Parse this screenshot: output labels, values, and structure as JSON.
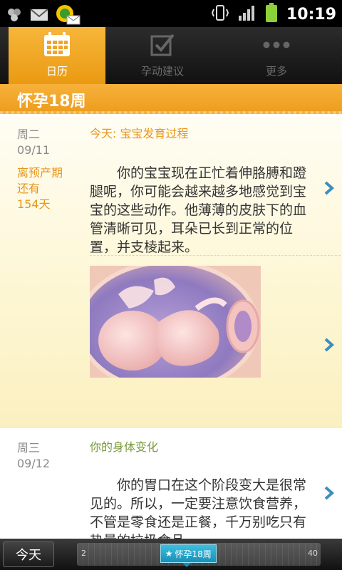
{
  "status_bar": {
    "time": "10:19"
  },
  "tabs": [
    {
      "label": "日历",
      "active": true,
      "icon": "calendar-icon"
    },
    {
      "label": "孕动建议",
      "active": false,
      "icon": "checkbox-icon"
    },
    {
      "label": "更多",
      "active": false,
      "icon": "more-dots-icon"
    }
  ],
  "week_header": {
    "title": "怀孕18周"
  },
  "days": [
    {
      "weekday": "周二",
      "date": "09/11",
      "due_line1": "离预产期",
      "due_line2": "还有",
      "due_line3": "154天",
      "section_title": "今天: 宝宝发育过程",
      "paragraph": "你的宝宝现在正忙着伸胳膊和蹬腿呢，你可能会越来越多地感觉到宝宝的这些动作。他薄薄的皮肤下的血管清晰可见，耳朵已长到正常的位置，并支棱起来。"
    },
    {
      "weekday": "周三",
      "date": "09/12",
      "section_title": "你的身体变化",
      "paragraph": "你的胃口在这个阶段变大是很常见的。所以，一定要注意饮食营养，不管是零食还是正餐，千万别吃只有热量的垃圾食品。"
    }
  ],
  "bottom_bar": {
    "today_button": "今天",
    "progress_start": "2",
    "progress_end": "40",
    "current_week_label": "怀孕18周",
    "current_week": 18
  },
  "colors": {
    "accent": "#ee9e20",
    "secondary_title": "#7a9a3a",
    "marker": "#1a8fb8"
  }
}
